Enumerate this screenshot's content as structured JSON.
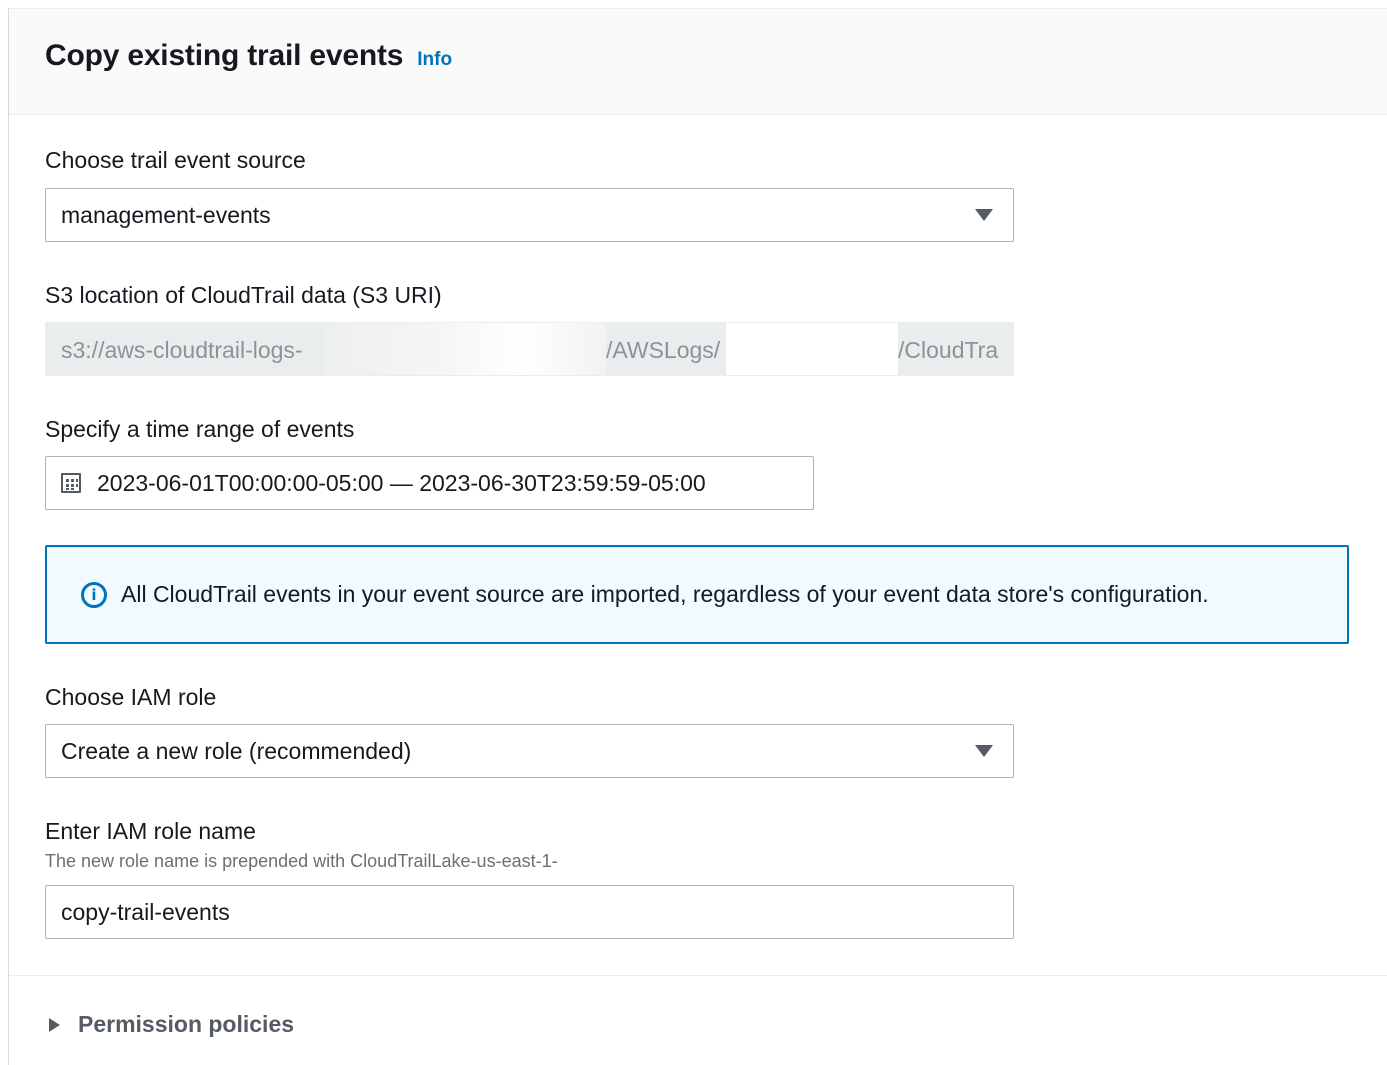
{
  "panel": {
    "title": "Copy existing trail events",
    "info_link": "Info"
  },
  "event_source": {
    "label": "Choose trail event source",
    "selected": "management-events"
  },
  "s3_location": {
    "label": "S3 location of CloudTrail data (S3 URI)",
    "segment_1": "s3://aws-cloudtrail-logs-",
    "segment_2": "/AWSLogs/",
    "segment_3": "/CloudTra"
  },
  "time_range": {
    "label": "Specify a time range of events",
    "value": "2023-06-01T00:00:00-05:00 — 2023-06-30T23:59:59-05:00",
    "icon": "calendar-icon"
  },
  "alert": {
    "icon": "info-icon",
    "message": "All CloudTrail events in your event source are imported, regardless of your event data store's configuration."
  },
  "iam_role": {
    "label": "Choose IAM role",
    "selected": "Create a new role (recommended)"
  },
  "role_name": {
    "label": "Enter IAM role name",
    "description": "The new role name is prepended with CloudTrailLake-us-east-1-",
    "value": "copy-trail-events"
  },
  "permission_policies": {
    "label": "Permission policies",
    "expanded": false
  },
  "colors": {
    "link": "#0073bb",
    "alert_bg": "#f1faff",
    "alert_border": "#0073bb",
    "text": "#16191f",
    "secondary_text": "#687078"
  }
}
